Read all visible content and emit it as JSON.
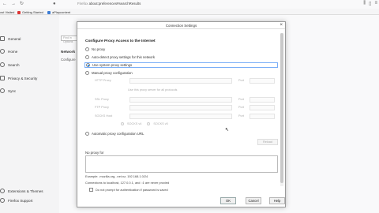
{
  "browser": {
    "url_prefix": "Firefox",
    "url": "about:preferences#searchResults",
    "bookmarks": [
      "ost Visited",
      "Getting Started",
      "aPlaycontent"
    ]
  },
  "sidebar": {
    "items": [
      "General",
      "Home",
      "Search",
      "Privacy & Security",
      "Sync"
    ],
    "bottom": [
      "Extensions & Themes",
      "Firefox Support"
    ]
  },
  "page": {
    "find_placeholder": "Find in Options",
    "section": "Network",
    "configure": "Configure"
  },
  "dialog": {
    "title": "Connection Settings",
    "section_title": "Configure Proxy Access to the Internet",
    "options": [
      "No proxy",
      "Auto-detect proxy settings for this network",
      "Use system proxy settings",
      "Manual proxy configuration"
    ],
    "selected_index": 2,
    "proxy_rows": [
      {
        "label": "HTTP Proxy",
        "port": "Port"
      },
      {
        "label": "SSL Proxy",
        "port": "Port"
      },
      {
        "label": "FTP Proxy",
        "port": "Port"
      },
      {
        "label": "SOCKS Host",
        "port": "Port"
      }
    ],
    "also_https": "Use this proxy server for all protocols",
    "socks_v4": "SOCKS v4",
    "socks_v5": "SOCKS v5",
    "auto_config": "Automatic proxy configuration URL",
    "reload": "Reload",
    "no_proxy_label": "No proxy for",
    "example": "Example: .mozilla.org, .net.nz, 192.168.1.0/24",
    "localhost_note": "Connections to localhost, 127.0.0.1, and ::1 are never proxied",
    "dont_prompt": "Do not prompt for authentication if password is saved",
    "buttons": {
      "ok": "OK",
      "cancel": "Cancel",
      "help": "Help"
    }
  },
  "colors": {
    "accent": "#0a84ff",
    "selected_border": "#7aaef7"
  }
}
